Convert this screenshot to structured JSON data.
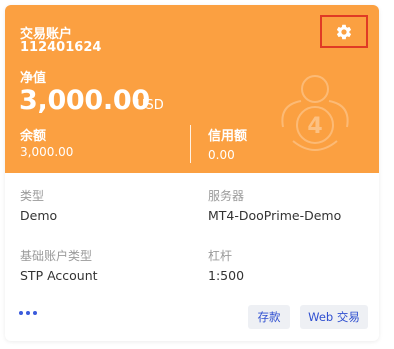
{
  "header": {
    "account_label": "交易账户",
    "account_number": "112401624",
    "net_value_label": "净值",
    "net_value": "3,000.00",
    "currency": "USD",
    "balance_label": "余额",
    "balance_value": "3,000.00",
    "credit_label": "信用额",
    "credit_value": "0.00",
    "watermark_text": "4",
    "background_color": "#fba041"
  },
  "settings": {
    "icon": "gear-icon"
  },
  "details": {
    "type_label": "类型",
    "type_value": "Demo",
    "server_label": "服务器",
    "server_value": "MT4-DooPrime-Demo",
    "base_type_label": "基础账户类型",
    "base_type_value": "STP Account",
    "leverage_label": "杠杆",
    "leverage_value": "1:500"
  },
  "actions": {
    "more_icon": "more-dots-icon",
    "deposit_label": "存款",
    "web_trade_label": "Web 交易",
    "accent_color": "#2f4fd0"
  }
}
